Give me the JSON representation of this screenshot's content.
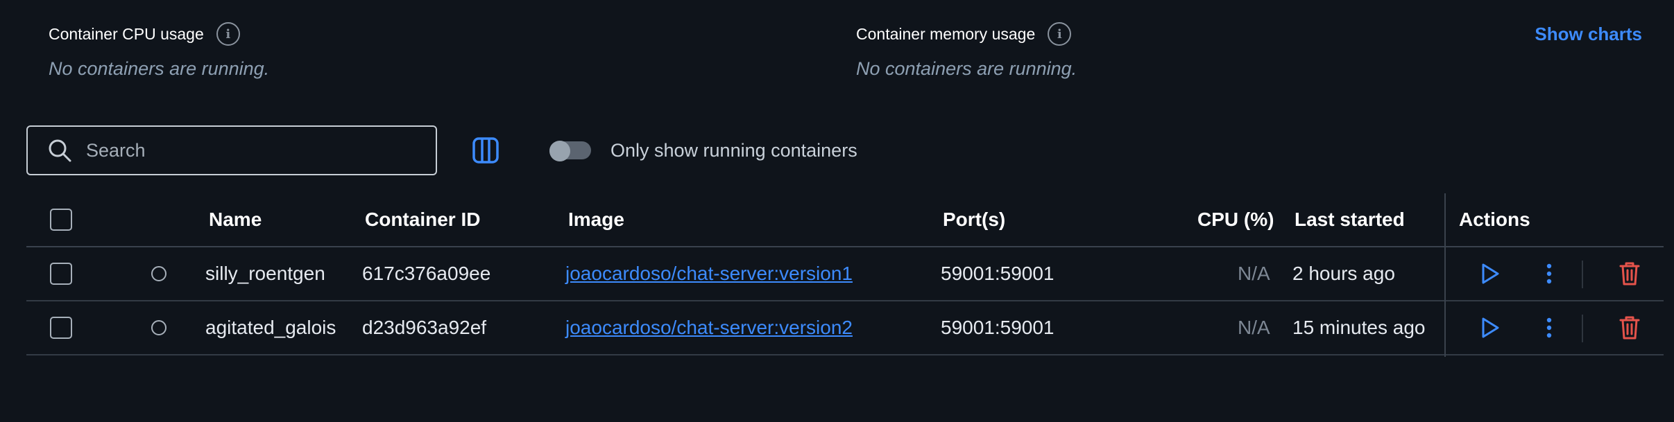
{
  "stats": {
    "cpu": {
      "title": "Container CPU usage",
      "empty": "No containers are running."
    },
    "memory": {
      "title": "Container memory usage",
      "empty": "No containers are running."
    },
    "show_charts": "Show charts",
    "info_glyph": "i"
  },
  "toolbar": {
    "search_placeholder": "Search",
    "toggle_label": "Only show running containers",
    "toggle_on": false
  },
  "table": {
    "headers": {
      "name": "Name",
      "container_id": "Container ID",
      "image": "Image",
      "ports": "Port(s)",
      "cpu": "CPU (%)",
      "last_started": "Last started",
      "actions": "Actions"
    },
    "rows": [
      {
        "name": "silly_roentgen",
        "container_id": "617c376a09ee",
        "image": "joaocardoso/chat-server:version1",
        "ports": "59001:59001",
        "cpu": "N/A",
        "last_started": "2 hours ago"
      },
      {
        "name": "agitated_galois",
        "container_id": "d23d963a92ef",
        "image": "joaocardoso/chat-server:version2",
        "ports": "59001:59001",
        "cpu": "N/A",
        "last_started": "15 minutes ago"
      }
    ]
  },
  "icons": {
    "search": "search-icon",
    "columns": "columns-icon",
    "play": "play-icon",
    "more": "more-vertical-icon",
    "delete": "trash-icon",
    "info": "info-icon"
  },
  "colors": {
    "background": "#0f141b",
    "accent": "#3d8bfd",
    "danger": "#e5534b",
    "muted_text": "#8ea0b3"
  }
}
